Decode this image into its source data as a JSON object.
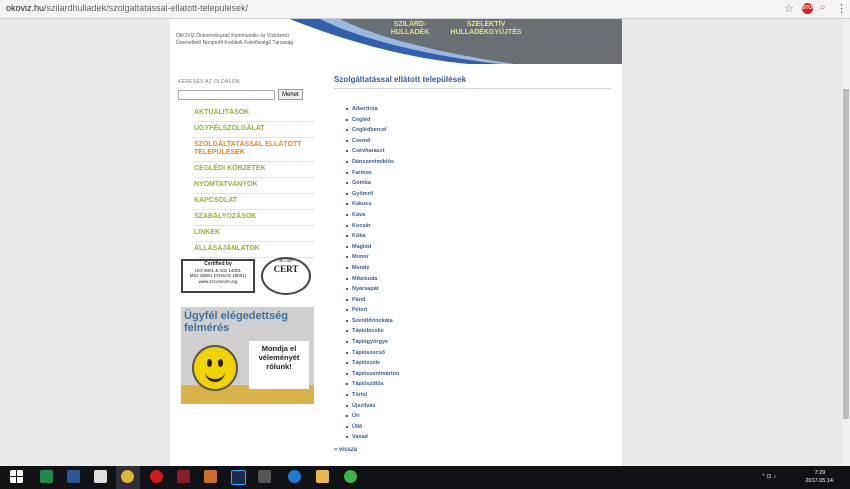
{
  "browser": {
    "url_host": "okoviz.hu",
    "url_path": "/szilardhulladek/szolgaltatassal-ellatott-telepulesek/",
    "star": "☆",
    "ext_stop_label": "STOP",
    "search_glyph": "⌕",
    "menu_glyph": "⋮"
  },
  "header": {
    "company_name": "ÖKOVÍZ Önkormányzati Kommunális és Vízközmű Üzemeltető Nonprofit Korlátolt Felelősségű Társaság",
    "nav": [
      "SZILÁRD-\nHULLADÉK",
      "SZELEKTÍV\nHULLADÉKGYŰJTÉS"
    ]
  },
  "sidebar": {
    "search_label": "KERESÉS AZ OLDALON",
    "search_placeholder": "",
    "search_button": "Mehet",
    "nav_items": [
      {
        "label": "AKTUALITÁSOK",
        "active": false
      },
      {
        "label": "ÜGYFÉLSZOLGÁLAT",
        "active": false
      },
      {
        "label": "SZOLGÁLTATÁSSAL ELLÁTOTT TELEPÜLÉSEK",
        "active": true
      },
      {
        "label": "CEGLÉDI KÖRZETEK",
        "active": false
      },
      {
        "label": "NYOMTATVÁNYOK",
        "active": false
      },
      {
        "label": "KAPCSOLAT",
        "active": false
      },
      {
        "label": "SZABÁLYOZÁSOK",
        "active": false
      },
      {
        "label": "LINKEK",
        "active": false
      },
      {
        "label": "ÁLLÁSAJÁNLATOK",
        "active": false
      }
    ],
    "cert": {
      "left_title": "Certified by",
      "left_line1": "ISO 9001 & ISO 14001",
      "left_line2": "MSz 28001 (OHSAS 18001)",
      "left_url": "www.szcomcert.org",
      "right_main": "CERT",
      "right_sub": "& com"
    },
    "survey": {
      "title": "Ügyfél elégedettség felmérés",
      "callout": "Mondja el véleményét rólunk!"
    }
  },
  "main": {
    "title": "Szolgáltatással ellátott települések",
    "towns": [
      "Albertirsa",
      "Cegléd",
      "Ceglédbercel",
      "Csemő",
      "Csévharaszt",
      "Dánszentmiklós",
      "Farmos",
      "Gomba",
      "Gyömrő",
      "Kakucs",
      "Káva",
      "Kocsér",
      "Kóka",
      "Maglód",
      "Monor",
      "Mende",
      "Mikebuda",
      "Nyársapát",
      "Pánd",
      "Péteri",
      "Szentlőrinckáta",
      "Tápióbicske",
      "Tápiógyörgye",
      "Tápiószecső",
      "Tápiószele",
      "Tápiószentmárton",
      "Tápiószőlős",
      "Törtel",
      "Újszilvás",
      "Úri",
      "Üllő",
      "Vasad"
    ],
    "back_label": "« vissza"
  },
  "taskbar": {
    "time": "7:29",
    "date": "2017.05.14.",
    "tray": "^ ⊡ ♪"
  }
}
